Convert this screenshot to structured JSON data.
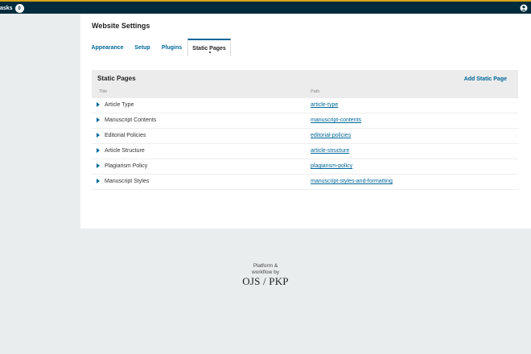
{
  "topbar": {
    "tasks_label": "asks",
    "tasks_count": "0",
    "user_icon": "user-icon"
  },
  "page": {
    "title": "Website Settings"
  },
  "tabs": [
    {
      "label": "Appearance"
    },
    {
      "label": "Setup"
    },
    {
      "label": "Plugins"
    },
    {
      "label": "Static Pages",
      "active": true
    }
  ],
  "static_pages": {
    "title": "Static Pages",
    "add_button": "Add Static Page",
    "columns": {
      "title": "Title",
      "path": "Path"
    },
    "rows": [
      {
        "title": "Article Type",
        "path": "article-type"
      },
      {
        "title": "Manuscript Contents",
        "path": "manuscript-contents"
      },
      {
        "title": "Editorial Policies",
        "path": "editorial-policies"
      },
      {
        "title": "Article Structure",
        "path": "article-structure"
      },
      {
        "title": "Plagiarism Policy",
        "path": "plagiarism-policy"
      },
      {
        "title": "Manuscript Styles",
        "path": "manuscript-styles-and-formatting"
      }
    ]
  },
  "footer": {
    "line1": "Platform &",
    "line2": "workflow by",
    "logo": "OJS / PKP"
  },
  "colors": {
    "topbar": "#002b3d",
    "accent": "#d7a31b",
    "link": "#006798"
  }
}
